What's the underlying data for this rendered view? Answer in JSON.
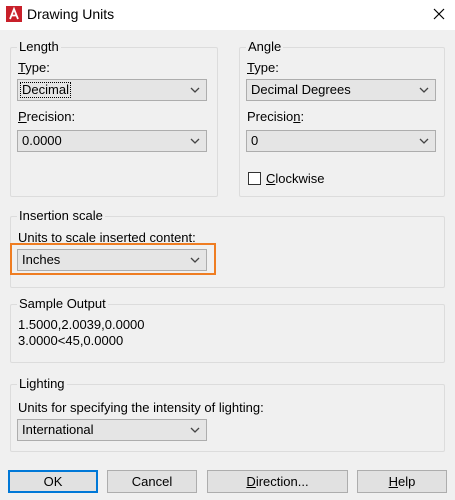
{
  "window": {
    "title": "Drawing Units",
    "close_icon": "close-icon"
  },
  "length": {
    "group_label": "Length",
    "type_label": "Type:",
    "type_value": "Decimal",
    "precision_label": "Precision:",
    "precision_value": "0.0000"
  },
  "angle": {
    "group_label": "Angle",
    "type_label": "Type:",
    "type_value": "Decimal Degrees",
    "precision_label": "Precision:",
    "precision_value": "0",
    "clockwise_label": "Clockwise",
    "clockwise_checked": false
  },
  "insertion": {
    "group_label": "Insertion scale",
    "units_label": "Units to scale inserted content:",
    "units_value": "Inches"
  },
  "sample": {
    "group_label": "Sample Output",
    "line1": "1.5000,2.0039,0.0000",
    "line2": "3.0000<45,0.0000"
  },
  "lighting": {
    "group_label": "Lighting",
    "units_label": "Units for specifying the intensity of lighting:",
    "units_value": "International"
  },
  "buttons": {
    "ok": "OK",
    "cancel": "Cancel",
    "direction": "Direction...",
    "help": "Help"
  },
  "colors": {
    "highlight": "#ef7d22",
    "default_button_border": "#0078d7"
  }
}
